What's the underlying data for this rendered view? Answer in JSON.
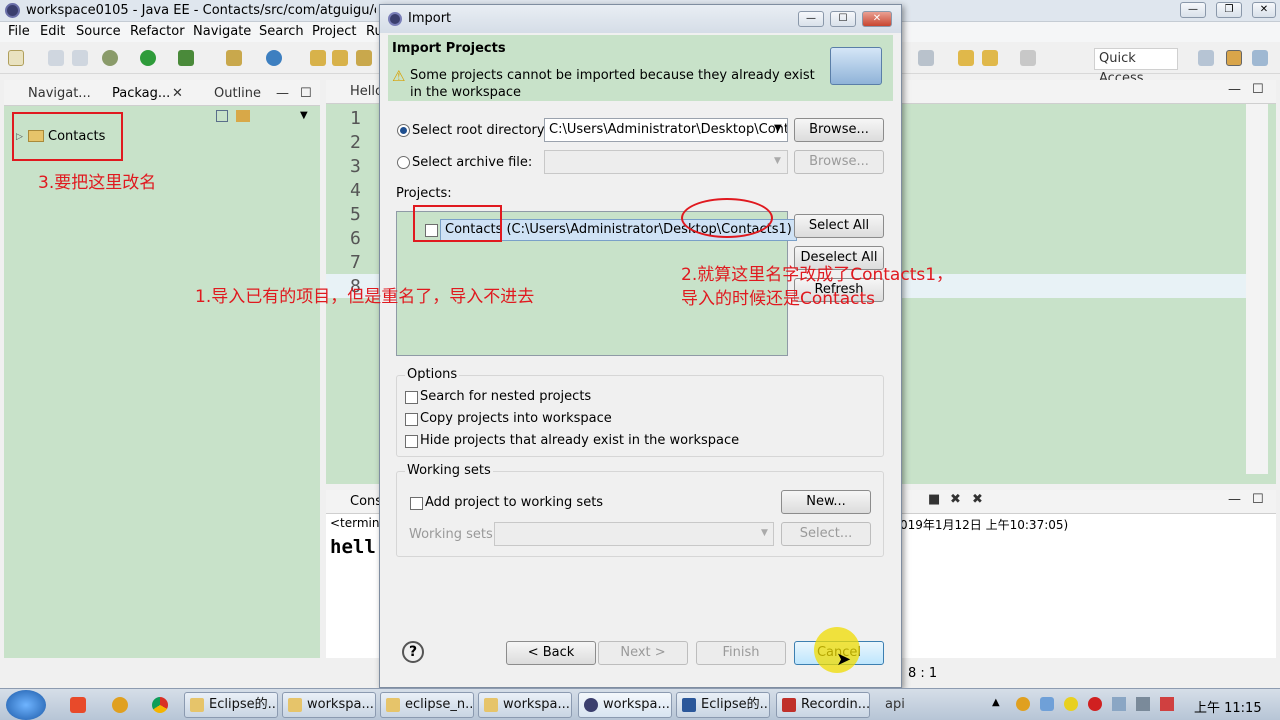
{
  "window": {
    "title": "workspace0105 - Java EE - Contacts/src/com/atguigu/contac"
  },
  "menu": [
    "File",
    "Edit",
    "Source",
    "Refactor",
    "Navigate",
    "Search",
    "Project",
    "Ru"
  ],
  "quick_access": "Quick Access",
  "left_tabs": [
    "Navigat...",
    "Packag...",
    "Outline"
  ],
  "tree": {
    "project": "Contacts"
  },
  "editor": {
    "tab": "Hello",
    "lines": [
      "1",
      "2",
      "3",
      "4",
      "5",
      "6",
      "7",
      "8"
    ]
  },
  "console": {
    "tab": "Cons",
    "terminated": "<termina",
    "output": "hell",
    "timestamp": "019年1月12日 上午10:37:05)",
    "position": "8 : 1"
  },
  "dialog": {
    "title": "Import",
    "heading": "Import Projects",
    "warning": "Some projects cannot be imported because they already exist in the workspace",
    "root_label": "Select root directory:",
    "root_value": "C:\\Users\\Administrator\\Desktop\\Cont",
    "archive_label": "Select archive file:",
    "browse": "Browse...",
    "projects_label": "Projects:",
    "project_item": "Contacts (C:\\Users\\Administrator\\Desktop\\Contacts1)",
    "select_all": "Select All",
    "deselect_all": "Deselect All",
    "refresh": "Refresh",
    "options_label": "Options",
    "opt_nested": "Search for nested projects",
    "opt_copy": "Copy projects into workspace",
    "opt_hide": "Hide projects that already exist in the workspace",
    "working_sets_label": "Working sets",
    "add_ws": "Add project to working sets",
    "new_btn": "New...",
    "ws_label": "Working sets:",
    "select_btn": "Select...",
    "help": "?",
    "back": "< Back",
    "next": "Next >",
    "finish": "Finish",
    "cancel": "Cancel"
  },
  "annotations": {
    "a1": "1.导入已有的项目，但是重名了，导入不进去",
    "a2_line1": "2.就算这里名字改成了Contacts1，",
    "a2_line2": "导入的时候还是Contacts",
    "a3": "3.要把这里改名"
  },
  "taskbar": {
    "items": [
      "Eclipse的...",
      "workspa...",
      "eclipse_n...",
      "workspa...",
      "workspa...",
      "Eclipse的...",
      "Recordin..."
    ],
    "tray_text": "api",
    "clock": "上午 11:15"
  }
}
